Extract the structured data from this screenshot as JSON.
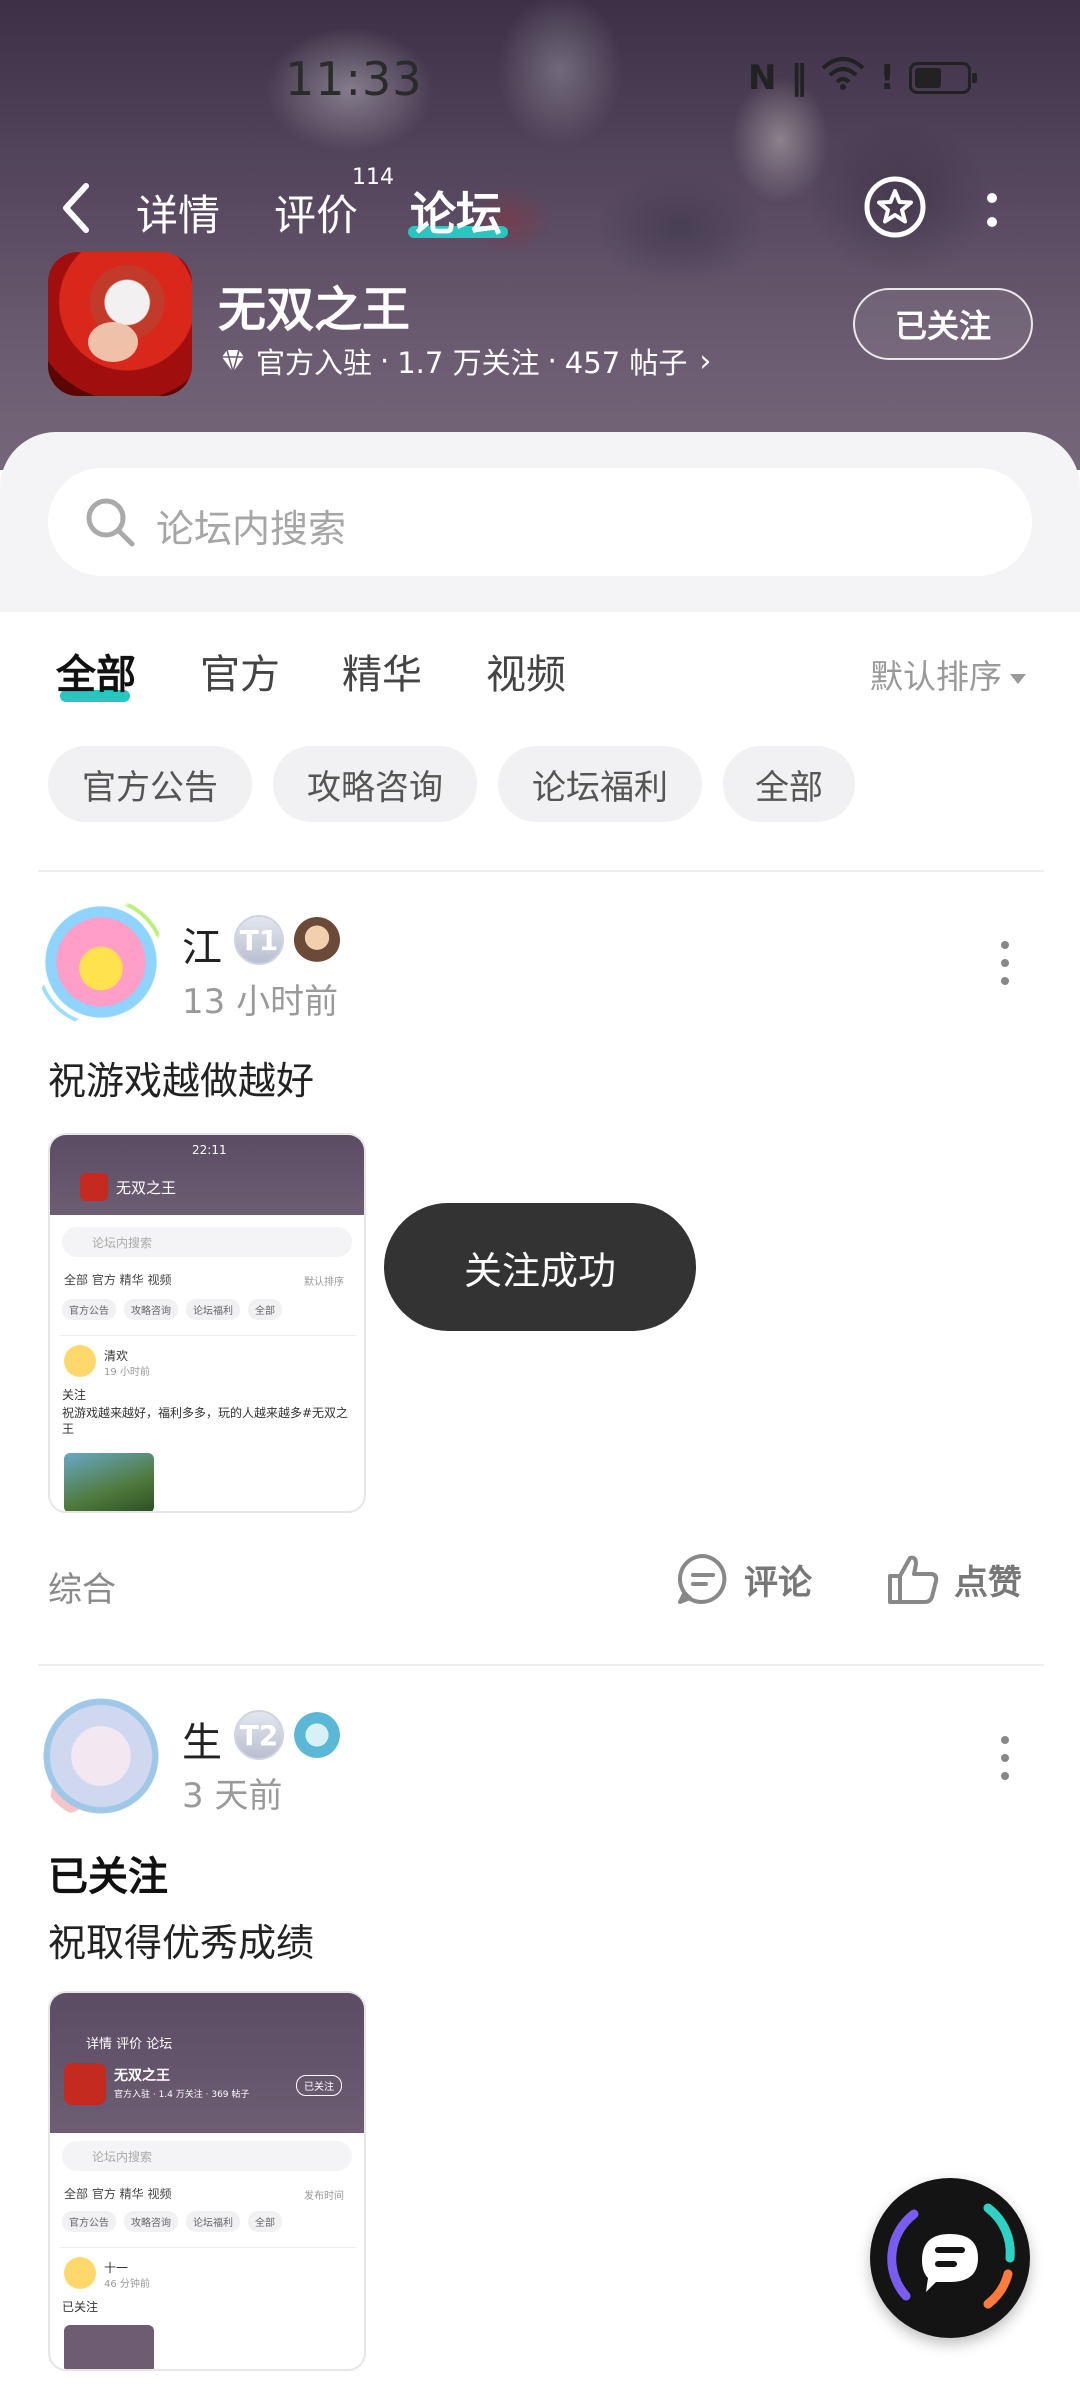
{
  "status_bar": {
    "time": "11:33"
  },
  "nav": {
    "tabs": [
      {
        "label": "详情"
      },
      {
        "label": "评价",
        "badge": "114"
      },
      {
        "label": "论坛"
      }
    ]
  },
  "game": {
    "name": "无双之王",
    "meta": {
      "official": "官方入驻",
      "followers": "1.7 万关注",
      "posts": "457 帖子"
    },
    "follow_label": "已关注"
  },
  "search": {
    "placeholder": "论坛内搜索"
  },
  "categories": {
    "tabs": [
      "全部",
      "官方",
      "精华",
      "视频"
    ],
    "sort": "默认排序"
  },
  "chips": [
    "官方公告",
    "攻略咨询",
    "论坛福利",
    "全部"
  ],
  "posts": [
    {
      "username": "江",
      "level": "T1",
      "time": "13 小时前",
      "text": "祝游戏越做越好",
      "tag": "综合",
      "actions": {
        "comment": "评论",
        "like": "点赞"
      },
      "thumb": {
        "time": "22:11",
        "title": "无双之王",
        "search": "论坛内搜索",
        "tabs": "全部  官方  精华  视频",
        "sort": "默认排序",
        "chips": [
          "官方公告",
          "攻略咨询",
          "论坛福利",
          "全部"
        ],
        "user": "清欢",
        "user_time": "19 小时前",
        "heading": "关注",
        "body": "祝游戏越来越好，福利多多，玩的人越来越多#无双之王"
      }
    },
    {
      "username": "生",
      "level": "T2",
      "time": "3 天前",
      "title": "已关注",
      "text": "祝取得优秀成绩",
      "thumb": {
        "nav": "详情   评价   论坛",
        "title": "无双之王",
        "meta": "官方入驻 · 1.4 万关注 · 369 帖子",
        "follow": "已关注",
        "search": "论坛内搜索",
        "tabs": "全部  官方  精华  视频",
        "sort": "发布时间",
        "chips": [
          "官方公告",
          "攻略咨询",
          "论坛福利",
          "全部"
        ],
        "user": "十一",
        "user_time": "46 分钟前",
        "heading": "已关注"
      }
    }
  ],
  "toast": "关注成功",
  "colors": {
    "accent": "#27c6c0",
    "toast_bg": "#333333",
    "header_bg": "#5a4a63"
  }
}
